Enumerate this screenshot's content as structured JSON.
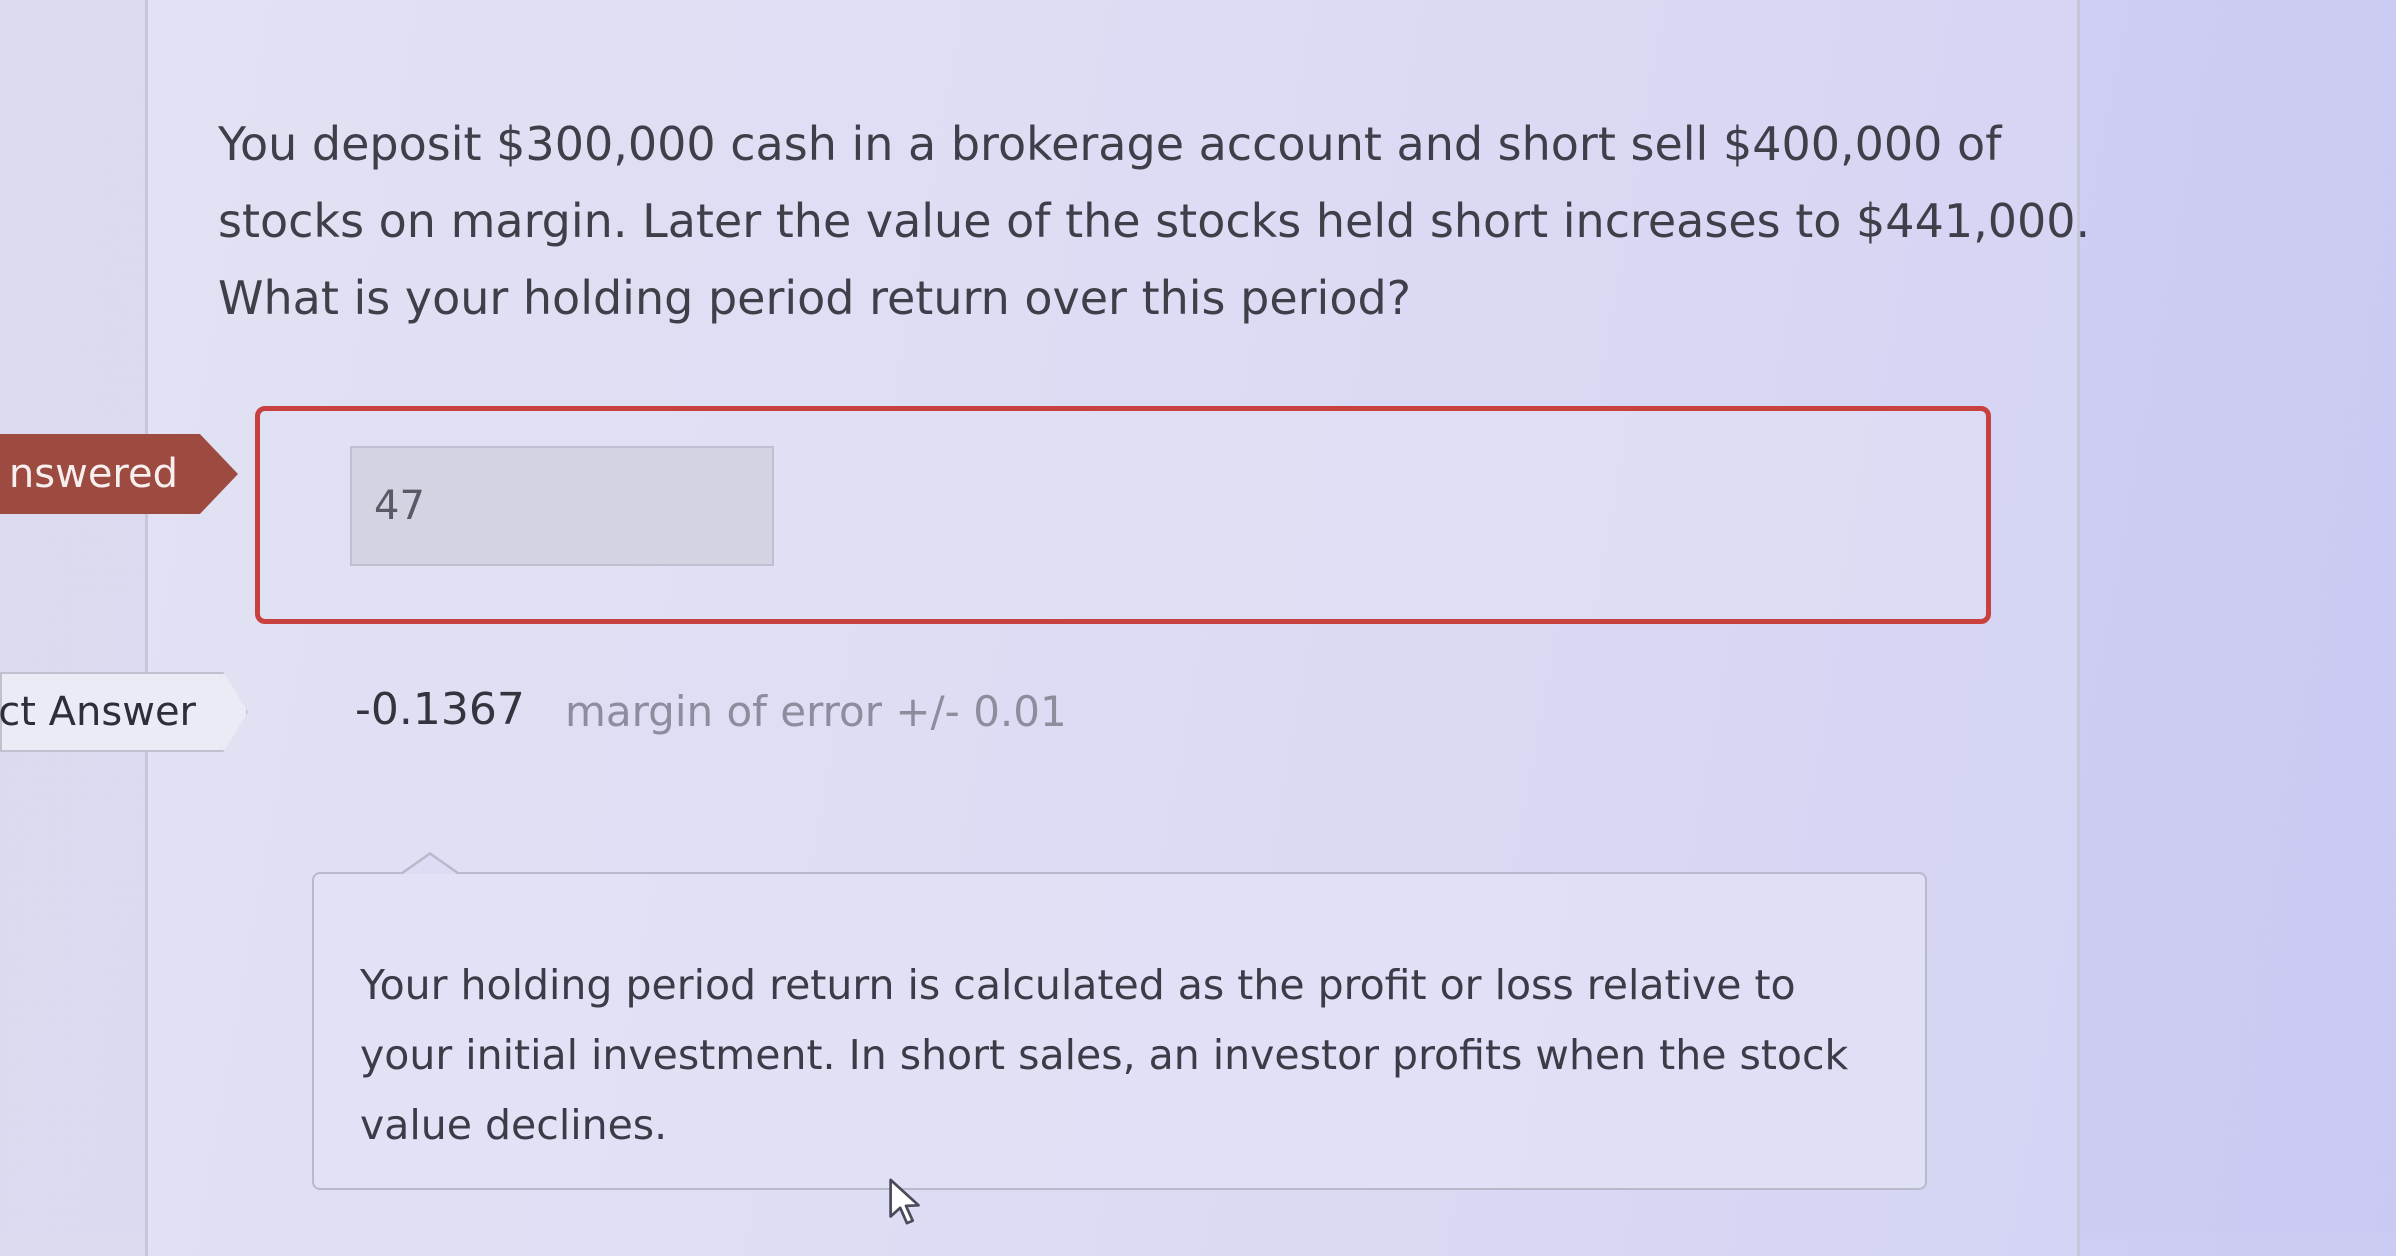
{
  "question": {
    "lines": [
      "You deposit $300,000 cash in a brokerage account and short sell $400,000 of",
      "stocks on margin. Later the value of the stocks held short increases to $441,000.",
      "What is your holding period return over this period?"
    ]
  },
  "status_tags": {
    "answered": "nswered",
    "correct_answer": "ct Answer"
  },
  "answer": {
    "value": "47"
  },
  "correct": {
    "value": "-0.1367",
    "margin": "margin of error +/- 0.01"
  },
  "feedback": {
    "lines": [
      "Your holding period return is calculated as the profit or loss relative to",
      "your initial investment. In short sales, an investor profits when the stock",
      "value declines."
    ]
  },
  "colors": {
    "incorrect_border": "#c9413f",
    "answered_tag": "#9d4a40"
  },
  "icons": {
    "cursor": "mouse-pointer-icon"
  }
}
